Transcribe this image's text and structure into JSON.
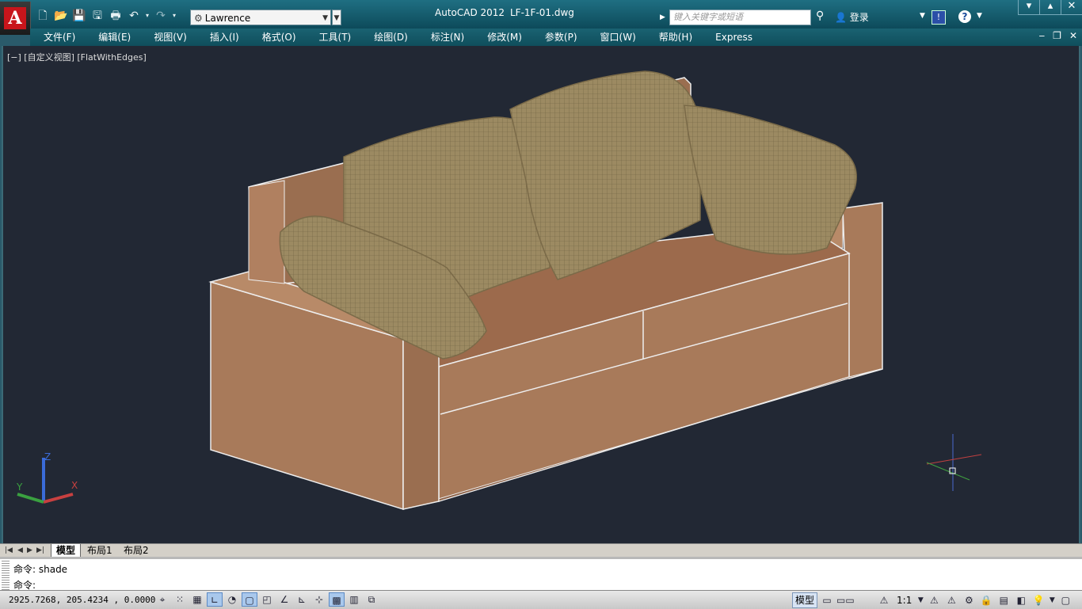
{
  "app": {
    "title": "AutoCAD 2012",
    "file": "LF-1F-01.dwg",
    "logo_letter": "A",
    "workspace": "Lawrence"
  },
  "search": {
    "placeholder": "键入关键字或短语"
  },
  "user": {
    "login_label": "登录"
  },
  "help": {
    "exchange": "!",
    "question": "?"
  },
  "window_controls": {
    "minimize": "▾",
    "maximize": "▴",
    "close": "✕"
  },
  "doc_controls": {
    "minimize": "‒",
    "restore": "❐",
    "close": "✕"
  },
  "menu": {
    "items": [
      "文件(F)",
      "编辑(E)",
      "视图(V)",
      "插入(I)",
      "格式(O)",
      "工具(T)",
      "绘图(D)",
      "标注(N)",
      "修改(M)",
      "参数(P)",
      "窗口(W)",
      "帮助(H)",
      "Express"
    ]
  },
  "viewport": {
    "label": "[−] [自定义视图] [FlatWithEdges]"
  },
  "ucs": {
    "x": "X",
    "y": "Y",
    "z": "Z"
  },
  "layout_tabs": [
    "模型",
    "布局1",
    "布局2"
  ],
  "command": {
    "history": "命令:  shade",
    "prompt": "命令:"
  },
  "status": {
    "coordinates": "2925.7268,  205.4234 ,  0.0000",
    "model_label": "模型",
    "scale": "1:1"
  },
  "colors": {
    "viewport_bg": "#222834",
    "sofa_body": "#a87a5a",
    "sofa_cushion": "#9c8a62",
    "title_bar": "#1f6f82"
  }
}
